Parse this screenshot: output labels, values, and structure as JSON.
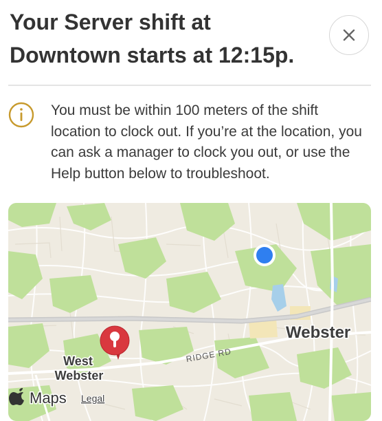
{
  "header": {
    "title": "Your Server shift at Downtown starts at 12:15p.",
    "close_icon": "close-icon"
  },
  "notice": {
    "icon": "info-icon",
    "accent_color": "#c79a2d",
    "text": "You must be within 100 meters of the shift location to clock out. If you’re at the location, you can ask a manager to clock you out, or use the Help button below to troubleshoot."
  },
  "map": {
    "place_labels": {
      "webster": "Webster",
      "west_webster": "West\nWebster",
      "road": "RIDGE RD"
    },
    "attribution": {
      "brand": "Maps",
      "legal": "Legal"
    },
    "colors": {
      "land": "#efebe1",
      "park": "#bfe09a",
      "water": "#a6cfea",
      "road": "#c9c9c9",
      "user_dot": "#2f7ff0",
      "pin": "#d9383f"
    }
  }
}
